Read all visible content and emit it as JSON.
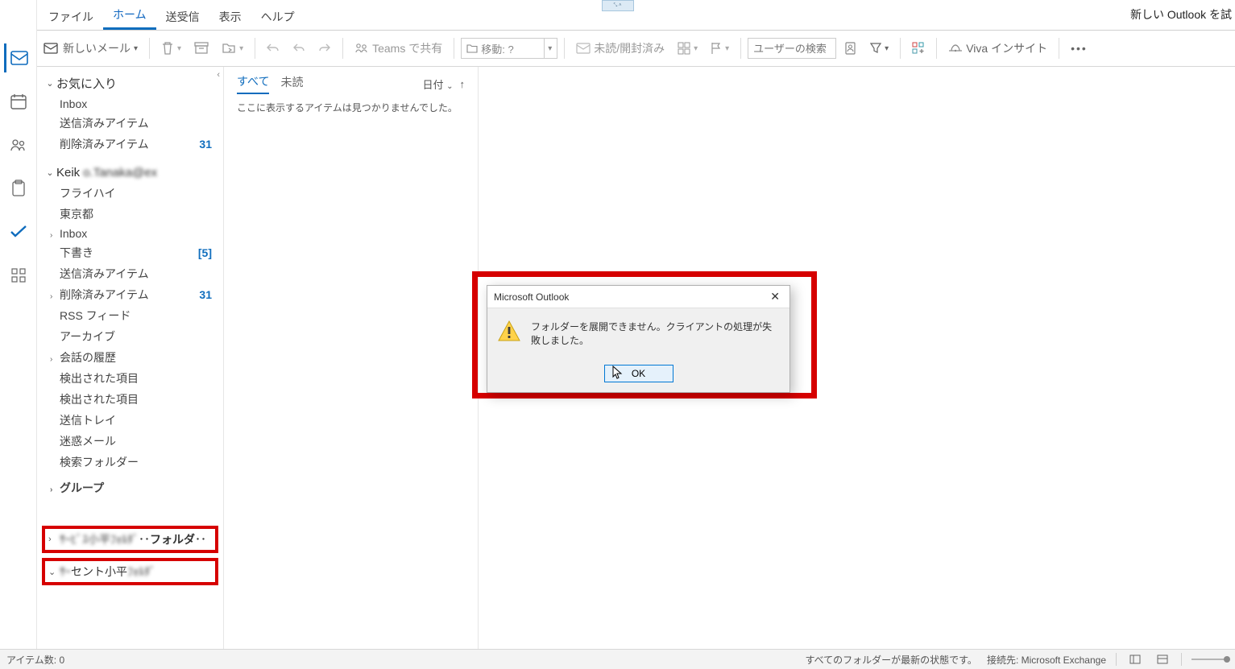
{
  "tabs": {
    "file": "ファイル",
    "home": "ホーム",
    "sendrecv": "送受信",
    "view": "表示",
    "help": "ヘルプ"
  },
  "new_outlook": "新しい Outlook を試",
  "ribbon": {
    "new_mail": "新しいメール",
    "teams_share": "Teams で共有",
    "move_placeholder": "移動: ?",
    "unread_read": "未読/開封済み",
    "user_search": "ユーザーの検索",
    "viva": "Viva インサイト"
  },
  "nav": {
    "favorites": "お気に入り",
    "inbox": "Inbox",
    "sent": "送信済みアイテム",
    "deleted": "削除済みアイテム",
    "deleted_count": "31",
    "account": "Keik",
    "flyhigh": "フライハイ",
    "tokyo": "東京都",
    "drafts": "下書き",
    "drafts_count": "[5]",
    "rss": "RSS フィード",
    "archive": "アーカイブ",
    "conv_history": "会話の履歴",
    "detected": "検出された項目",
    "outbox": "送信トレイ",
    "junk": "迷惑メール",
    "search_folders": "検索フォルダー",
    "groups": "グループ",
    "acct2_tail": "‥フォルダ‥",
    "acct3_mid": "セント小平"
  },
  "list": {
    "all": "すべて",
    "unread": "未読",
    "sort_label": "日付",
    "empty": "ここに表示するアイテムは見つかりませんでした。"
  },
  "dialog": {
    "title": "Microsoft Outlook",
    "message": "フォルダーを展開できません。クライアントの処理が失敗しました。",
    "ok": "OK"
  },
  "status": {
    "items": "アイテム数: 0",
    "sync": "すべてのフォルダーが最新の状態です。",
    "connected": "接続先: Microsoft Exchange"
  }
}
